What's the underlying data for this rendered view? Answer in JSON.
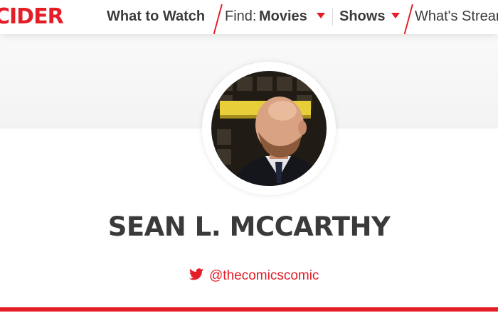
{
  "nav": {
    "logo": "CIDER",
    "what_to_watch": "What to Watch",
    "find_label": "Find:",
    "movies": "Movies",
    "shows": "Shows",
    "whats_streaming": "What's Stream"
  },
  "profile": {
    "name": "SEAN L. MCCARTHY",
    "twitter_handle": "@thecomicscomic"
  },
  "icons": {
    "twitter": "twitter-bird-icon",
    "dropdown": "caret-down-icon"
  },
  "colors": {
    "brand_red": "#e41d26",
    "text_dark": "#3a3a3a"
  }
}
